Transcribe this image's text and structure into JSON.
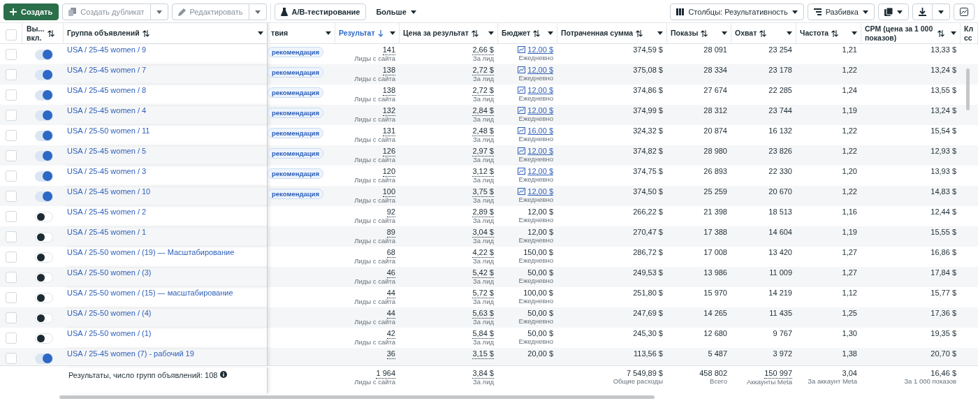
{
  "toolbar": {
    "left": [
      {
        "kind": "primary",
        "label": "Создать",
        "disabled": false
      },
      {
        "kind": "split",
        "label": "Создать дубликат",
        "disabled": true
      },
      {
        "kind": "split",
        "label": "Редактировать",
        "disabled": true
      },
      {
        "kind": "plain",
        "label": "A/B-тестирование",
        "disabled": false
      },
      {
        "kind": "menu",
        "label": "Больше",
        "disabled": false
      }
    ],
    "right": [
      {
        "kind": "menu",
        "label": "Столбцы: Результативность"
      },
      {
        "kind": "menu",
        "label": "Разбивка"
      },
      {
        "kind": "icon-menu"
      },
      {
        "kind": "icon-split"
      },
      {
        "kind": "icon"
      }
    ]
  },
  "table": {
    "select_all": {
      "selected": false
    },
    "columns": [
      {
        "label": "Вы... вкл.",
        "kind": "sortable",
        "menu": false,
        "selected": false
      },
      {
        "label": "Группа объявлений",
        "kind": "sortable",
        "menu": true,
        "selected": false
      },
      {
        "label": "твия",
        "kind": "plain",
        "menu": true,
        "selected": false
      },
      {
        "label": "Результат",
        "kind": "sorted",
        "menu": true,
        "selected": true
      },
      {
        "label": "Цена за результат",
        "kind": "sortable",
        "menu": true,
        "selected": false
      },
      {
        "label": "Бюджет",
        "kind": "sortable",
        "menu": true,
        "selected": false
      },
      {
        "label": "Потраченная сумма",
        "kind": "sortable",
        "menu": true,
        "selected": false
      },
      {
        "label": "Показы",
        "kind": "sortable",
        "menu": true,
        "selected": false
      },
      {
        "label": "Охват",
        "kind": "sortable",
        "menu": true,
        "selected": false
      },
      {
        "label": "Частота",
        "kind": "sortable",
        "menu": true,
        "selected": false
      },
      {
        "label": "CPM (цена за 1 000 показов)",
        "kind": "sortable",
        "menu": true,
        "selected": false
      },
      {
        "label": "Кл сс",
        "kind": "plain",
        "menu": false,
        "selected": false
      }
    ],
    "rows": [
      {
        "selected": false,
        "on": true,
        "name": "USA / 25-45 women / 9",
        "recommendation": "рекомендация",
        "result": "141",
        "result_note": "Лиды с сайта",
        "price": "2,66 $",
        "price_note": "За лид",
        "budget": "12,00 $",
        "budget_linked": true,
        "budget_note": "Ежедневно",
        "spent": "374,59 $",
        "impressions": "28 091",
        "reach": "23 254",
        "frequency": "1,21",
        "cpm": "13,33 $"
      },
      {
        "selected": false,
        "on": true,
        "name": "USA / 25-45 women / 7",
        "recommendation": "рекомендация",
        "result": "138",
        "result_note": "Лиды с сайта",
        "price": "2,72 $",
        "price_note": "За лид",
        "budget": "12,00 $",
        "budget_linked": true,
        "budget_note": "Ежедневно",
        "spent": "375,08 $",
        "impressions": "28 334",
        "reach": "23 178",
        "frequency": "1,22",
        "cpm": "13,24 $"
      },
      {
        "selected": false,
        "on": true,
        "name": "USA / 25-45 women / 8",
        "recommendation": "рекомендация",
        "result": "138",
        "result_note": "Лиды с сайта",
        "price": "2,72 $",
        "price_note": "За лид",
        "budget": "12,00 $",
        "budget_linked": true,
        "budget_note": "Ежедневно",
        "spent": "374,86 $",
        "impressions": "27 674",
        "reach": "22 285",
        "frequency": "1,24",
        "cpm": "13,55 $"
      },
      {
        "selected": false,
        "on": true,
        "name": "USA / 25-45 women / 4",
        "recommendation": "рекомендация",
        "result": "132",
        "result_note": "Лиды с сайта",
        "price": "2,84 $",
        "price_note": "За лид",
        "budget": "12,00 $",
        "budget_linked": true,
        "budget_note": "Ежедневно",
        "spent": "374,99 $",
        "impressions": "28 312",
        "reach": "23 744",
        "frequency": "1,19",
        "cpm": "13,24 $"
      },
      {
        "selected": false,
        "on": true,
        "name": "USA / 25-50 women / 11",
        "recommendation": "рекомендация",
        "result": "131",
        "result_note": "Лиды с сайта",
        "price": "2,48 $",
        "price_note": "За лид",
        "budget": "16,00 $",
        "budget_linked": true,
        "budget_note": "Ежедневно",
        "spent": "324,32 $",
        "impressions": "20 874",
        "reach": "16 132",
        "frequency": "1,22",
        "cpm": "15,54 $"
      },
      {
        "selected": false,
        "on": true,
        "name": "USA / 25-45 women / 5",
        "recommendation": "рекомендация",
        "result": "126",
        "result_note": "Лиды с сайта",
        "price": "2,97 $",
        "price_note": "За лид",
        "budget": "12,00 $",
        "budget_linked": true,
        "budget_note": "Ежедневно",
        "spent": "374,82 $",
        "impressions": "28 980",
        "reach": "23 826",
        "frequency": "1,22",
        "cpm": "12,93 $"
      },
      {
        "selected": false,
        "on": true,
        "name": "USA / 25-45 women / 3",
        "recommendation": "рекомендация",
        "result": "120",
        "result_note": "Лиды с сайта",
        "price": "3,12 $",
        "price_note": "За лид",
        "budget": "12,00 $",
        "budget_linked": true,
        "budget_note": "Ежедневно",
        "spent": "374,75 $",
        "impressions": "26 893",
        "reach": "22 330",
        "frequency": "1,20",
        "cpm": "13,93 $"
      },
      {
        "selected": false,
        "on": true,
        "name": "USA / 25-45 women / 10",
        "recommendation": "рекомендация",
        "result": "100",
        "result_note": "Лиды с сайта",
        "price": "3,75 $",
        "price_note": "За лид",
        "budget": "12,00 $",
        "budget_linked": true,
        "budget_note": "Ежедневно",
        "spent": "374,50 $",
        "impressions": "25 259",
        "reach": "20 670",
        "frequency": "1,22",
        "cpm": "14,83 $"
      },
      {
        "selected": false,
        "on": false,
        "name": "USA / 25-45 women / 2",
        "result": "92",
        "result_note": "Лиды с сайта",
        "price": "2,89 $",
        "price_note": "За лид",
        "budget": "12,00 $",
        "budget_linked": false,
        "budget_note": "Ежедневно",
        "spent": "266,22 $",
        "impressions": "21 398",
        "reach": "18 513",
        "frequency": "1,16",
        "cpm": "12,44 $"
      },
      {
        "selected": false,
        "on": false,
        "name": "USA / 25-45 women / 1",
        "result": "89",
        "result_note": "Лиды с сайта",
        "price": "3,04 $",
        "price_note": "За лид",
        "budget": "12,00 $",
        "budget_linked": false,
        "budget_note": "Ежедневно",
        "spent": "270,47 $",
        "impressions": "17 388",
        "reach": "14 604",
        "frequency": "1,19",
        "cpm": "15,55 $"
      },
      {
        "selected": false,
        "on": false,
        "name": "USA / 25-50 women / (19) — Масштабирование",
        "result": "68",
        "result_note": "Лиды с сайта",
        "price": "4,22 $",
        "price_note": "За лид",
        "budget": "150,00 $",
        "budget_linked": false,
        "budget_note": "Ежедневно",
        "spent": "286,72 $",
        "impressions": "17 008",
        "reach": "13 420",
        "frequency": "1,27",
        "cpm": "16,86 $"
      },
      {
        "selected": false,
        "on": false,
        "name": "USA / 25-50 women / (3)",
        "result": "46",
        "result_note": "Лиды с сайта",
        "price": "5,42 $",
        "price_note": "За лид",
        "budget": "50,00 $",
        "budget_linked": false,
        "budget_note": "Ежедневно",
        "spent": "249,53 $",
        "impressions": "13 986",
        "reach": "11 009",
        "frequency": "1,27",
        "cpm": "17,84 $"
      },
      {
        "selected": false,
        "on": false,
        "name": "USA / 25-50 women / (15) — масштабирование",
        "result": "44",
        "result_note": "Лиды с сайта",
        "price": "5,72 $",
        "price_note": "За лид",
        "budget": "100,00 $",
        "budget_linked": false,
        "budget_note": "Ежедневно",
        "spent": "251,80 $",
        "impressions": "15 970",
        "reach": "14 219",
        "frequency": "1,12",
        "cpm": "15,77 $"
      },
      {
        "selected": false,
        "on": false,
        "name": "USA / 25-50 women / (4)",
        "result": "44",
        "result_note": "Лиды с сайта",
        "price": "5,63 $",
        "price_note": "За лид",
        "budget": "50,00 $",
        "budget_linked": false,
        "budget_note": "Ежедневно",
        "spent": "247,69 $",
        "impressions": "14 265",
        "reach": "11 435",
        "frequency": "1,25",
        "cpm": "17,36 $"
      },
      {
        "selected": false,
        "on": false,
        "name": "USA / 25-50 women / (1)",
        "result": "42",
        "result_note": "Лиды с сайта",
        "price": "5,84 $",
        "price_note": "За лид",
        "budget": "50,00 $",
        "budget_linked": false,
        "budget_note": "Ежедневно",
        "spent": "245,30 $",
        "impressions": "12 680",
        "reach": "9 767",
        "frequency": "1,30",
        "cpm": "19,35 $"
      },
      {
        "selected": false,
        "on": true,
        "name": "USA / 25-45 women (7) - рабочий 19",
        "result": "36",
        "price": "3,15 $",
        "budget": "20,00 $",
        "budget_linked": false,
        "spent": "113,56 $",
        "impressions": "5 487",
        "reach": "3 972",
        "frequency": "1,38",
        "cpm": "20,70 $"
      }
    ],
    "totals": {
      "label": "Результаты, число групп объявлений: 108",
      "result": "1 964",
      "result_note": "Лиды с сайта",
      "price": "3,84 $",
      "price_note": "За лид",
      "spent": "7 549,89 $",
      "spent_note": "Общие расходы",
      "impressions": "458 802",
      "impressions_note": "Всего",
      "reach": "150 997",
      "reach_note": "Аккаунты Meta",
      "frequency": "3,04",
      "frequency_note": "За аккаунт Meta",
      "cpm": "16,46 $",
      "cpm_note": "За 1 000 показов"
    }
  }
}
